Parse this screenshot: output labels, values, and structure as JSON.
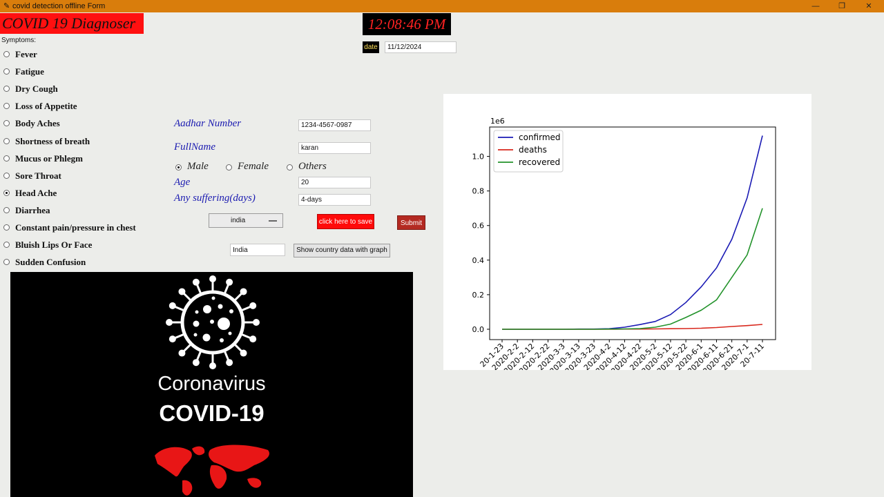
{
  "window": {
    "title": "covid detection offline Form",
    "controls": {
      "minimize": "—",
      "restore": "❐",
      "close": "✕"
    }
  },
  "header": {
    "banner": "COVID 19 Diagnoser",
    "clock": "12:08:46 PM",
    "date_label": "date",
    "date_value": "11/12/2024"
  },
  "symptoms": {
    "label": "Symptoms:",
    "items": [
      {
        "label": "Fever",
        "selected": false
      },
      {
        "label": "Fatigue",
        "selected": false
      },
      {
        "label": "Dry Cough",
        "selected": false
      },
      {
        "label": "Loss of Appetite",
        "selected": false
      },
      {
        "label": "Body Aches",
        "selected": false
      },
      {
        "label": "Shortness of breath",
        "selected": false
      },
      {
        "label": "Mucus or Phlegm",
        "selected": false
      },
      {
        "label": "Sore Throat",
        "selected": false
      },
      {
        "label": "Head Ache",
        "selected": true
      },
      {
        "label": "Diarrhea",
        "selected": false
      },
      {
        "label": "Constant pain/pressure in chest",
        "selected": false
      },
      {
        "label": "Bluish Lips Or Face",
        "selected": false
      },
      {
        "label": "Sudden Confusion",
        "selected": false
      }
    ]
  },
  "form": {
    "aadhar_label": "Aadhar Number",
    "aadhar_value": "1234-4567-0987",
    "fullname_label": "FullName",
    "fullname_value": "karan",
    "gender": {
      "options": [
        "Male",
        "Female",
        "Others"
      ],
      "selected": "Male"
    },
    "age_label": "Age",
    "age_value": "20",
    "suffering_label": "Any suffering(days)",
    "suffering_value": "4-days",
    "country_select": "india",
    "save_button": "click here to save",
    "submit_button": "Submit",
    "country_input": "India",
    "show_graph_button": "Show country data with graph"
  },
  "poster": {
    "line1": "Coronavirus",
    "line2": "COVID-19"
  },
  "colors": {
    "accent_orange": "#d97d0c",
    "banner_red": "#ff1010",
    "label_blue": "#1919b0",
    "confirmed": "#1a1ab4",
    "deaths": "#d8261b",
    "recovered": "#22922a"
  },
  "chart_data": {
    "type": "line",
    "x": [
      "2020-1-23",
      "2020-2-2",
      "2020-2-12",
      "2020-2-22",
      "2020-3-3",
      "2020-3-13",
      "2020-3-23",
      "2020-4-2",
      "2020-4-12",
      "2020-4-22",
      "2020-5-2",
      "2020-5-12",
      "2020-5-22",
      "2020-6-1",
      "2020-6-11",
      "2020-6-21",
      "2020-7-1",
      "2020-7-11"
    ],
    "tick_labels": [
      "20-1-23",
      "2020-2-2",
      "2020-2-12",
      "2020-2-22",
      "2020-3-3",
      "2020-3-13",
      "2020-3-23",
      "2020-4-2",
      "2020-4-12",
      "2020-4-22",
      "2020-5-2",
      "2020-5-12",
      "2020-5-22",
      "2020-6-1",
      "2020-6-11",
      "2020-6-21",
      "2020-7-1",
      "20-7-11"
    ],
    "offset_label": "1e6",
    "ylim": [
      -0.06,
      1.17
    ],
    "yticks": [
      "0.0",
      "0.2",
      "0.4",
      "0.6",
      "0.8",
      "1.0"
    ],
    "grid": false,
    "legend": "top-left",
    "series": [
      {
        "name": "confirmed",
        "color": "#1a1ab4",
        "values": [
          0,
          0,
          0,
          0,
          0,
          0.001,
          0.001,
          0.003,
          0.012,
          0.027,
          0.045,
          0.085,
          0.155,
          0.245,
          0.355,
          0.52,
          0.76,
          1.12
        ]
      },
      {
        "name": "deaths",
        "color": "#d8261b",
        "values": [
          0,
          0,
          0,
          0,
          0,
          0,
          0,
          0,
          0.001,
          0.001,
          0.002,
          0.003,
          0.004,
          0.006,
          0.01,
          0.016,
          0.021,
          0.028
        ]
      },
      {
        "name": "recovered",
        "color": "#22922a",
        "values": [
          0,
          0,
          0,
          0,
          0,
          0,
          0,
          0.001,
          0.002,
          0.004,
          0.012,
          0.03,
          0.068,
          0.11,
          0.17,
          0.3,
          0.43,
          0.7
        ]
      }
    ]
  }
}
